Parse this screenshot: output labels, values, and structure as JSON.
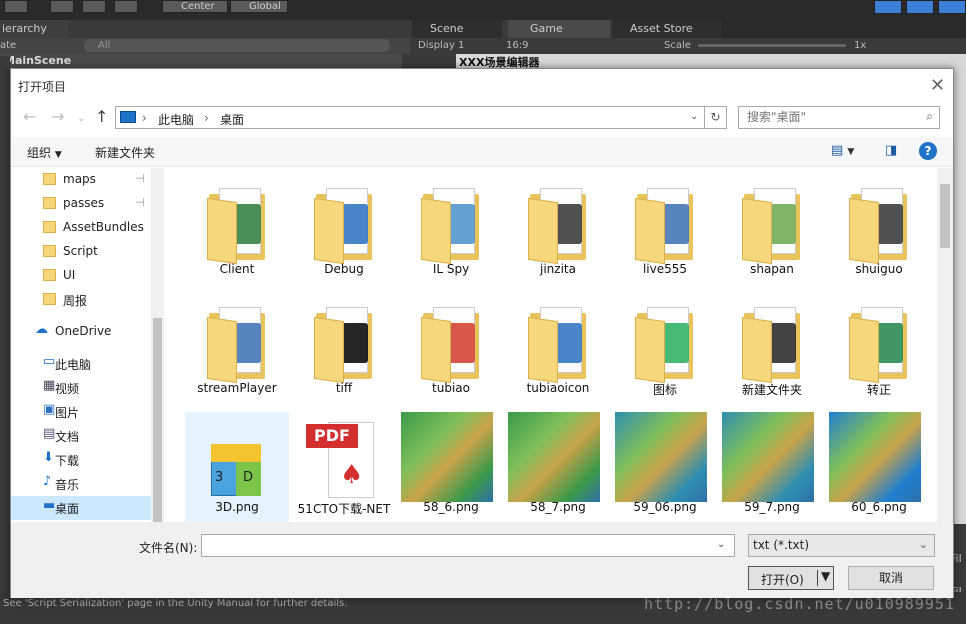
{
  "unity": {
    "center_label": "Center",
    "global_label": "Global",
    "hierarchy_tab": "ierarchy",
    "create_label": "ate",
    "search_all": "All",
    "scene_name": "MainScene",
    "scene_tab": "Scene",
    "game_tab": "Game",
    "asset_store_tab": "Asset Store",
    "display": "Display 1",
    "aspect": "16:9",
    "scale_label": "Scale",
    "scale_value": "1x",
    "game_title": "XXX场景编辑器",
    "console_text": "See 'Script Serialization' page in the Unity Manual for further details.",
    "right_file_1": "Fil",
    "right_file_2": "Fil",
    "watermark": "http://blog.csdn.net/u010989951"
  },
  "dialog": {
    "title": "打开项目",
    "address": {
      "crumbs": [
        "此电脑",
        "桌面"
      ]
    },
    "search_placeholder": "搜索\"桌面\"",
    "toolbar": {
      "organize": "组织",
      "new_folder": "新建文件夹"
    },
    "sidebar": [
      {
        "label": "maps",
        "icon": "folder-icon",
        "pinned": true
      },
      {
        "label": "passes",
        "icon": "folder-icon",
        "pinned": true
      },
      {
        "label": "AssetBundles",
        "icon": "folder-icon",
        "pinned": false
      },
      {
        "label": "Script",
        "icon": "folder-icon",
        "pinned": false
      },
      {
        "label": "UI",
        "icon": "folder-icon",
        "pinned": false
      },
      {
        "label": "周报",
        "icon": "folder-icon",
        "pinned": false
      },
      {
        "label": "OneDrive",
        "icon": "cloud-icon",
        "pinned": false
      },
      {
        "label": "此电脑",
        "icon": "computer-icon",
        "pinned": false
      },
      {
        "label": "视频",
        "icon": "video-icon",
        "pinned": false
      },
      {
        "label": "图片",
        "icon": "picture-icon",
        "pinned": false
      },
      {
        "label": "文档",
        "icon": "document-icon",
        "pinned": false
      },
      {
        "label": "下载",
        "icon": "download-icon",
        "pinned": false
      },
      {
        "label": "音乐",
        "icon": "music-icon",
        "pinned": false
      },
      {
        "label": "桌面",
        "icon": "desktop-icon",
        "pinned": false
      }
    ],
    "files": [
      {
        "name": "Client",
        "kind": "folder",
        "accent": "#2b7a3a"
      },
      {
        "name": "Debug",
        "kind": "folder",
        "accent": "#2a6fc0"
      },
      {
        "name": "IL Spy",
        "kind": "folder",
        "accent": "#4a90c8"
      },
      {
        "name": "jinzita",
        "kind": "folder",
        "accent": "#333333"
      },
      {
        "name": "live555",
        "kind": "folder",
        "accent": "#3a6fb0"
      },
      {
        "name": "shapan",
        "kind": "folder",
        "accent": "#6aa84f"
      },
      {
        "name": "shuiguo",
        "kind": "folder",
        "accent": "#333333"
      },
      {
        "name": "streamPlayer",
        "kind": "folder",
        "accent": "#3a6fb0"
      },
      {
        "name": "tiff",
        "kind": "folder",
        "accent": "#000000"
      },
      {
        "name": "tubiao",
        "kind": "folder",
        "accent": "#d0392b"
      },
      {
        "name": "tubiaoicon",
        "kind": "folder",
        "accent": "#2a6fc0"
      },
      {
        "name": "图标",
        "kind": "folder",
        "accent": "#27ae60"
      },
      {
        "name": "新建文件夹",
        "kind": "folder",
        "accent": "#222222"
      },
      {
        "name": "转正",
        "kind": "folder",
        "accent": "#1e8449"
      },
      {
        "name": "3D.png",
        "kind": "image3d",
        "accent": "#f4c430"
      },
      {
        "name": "51CTO下载-NET",
        "kind": "pdf",
        "accent": "#d32f2f"
      },
      {
        "name": "58_6.png",
        "kind": "terrain",
        "accent": "#3a9a4a"
      },
      {
        "name": "58_7.png",
        "kind": "terrain",
        "accent": "#3a9a4a"
      },
      {
        "name": "59_06.png",
        "kind": "terrain",
        "accent": "#2f8fb0"
      },
      {
        "name": "59_7.png",
        "kind": "terrain",
        "accent": "#2f8fb0"
      },
      {
        "name": "60_6.png",
        "kind": "terrain",
        "accent": "#1f7fd0"
      }
    ],
    "filename_label": "文件名(N):",
    "filename_value": "",
    "filetype": "txt (*.txt)",
    "open_label": "打开(O)",
    "cancel_label": "取消"
  }
}
